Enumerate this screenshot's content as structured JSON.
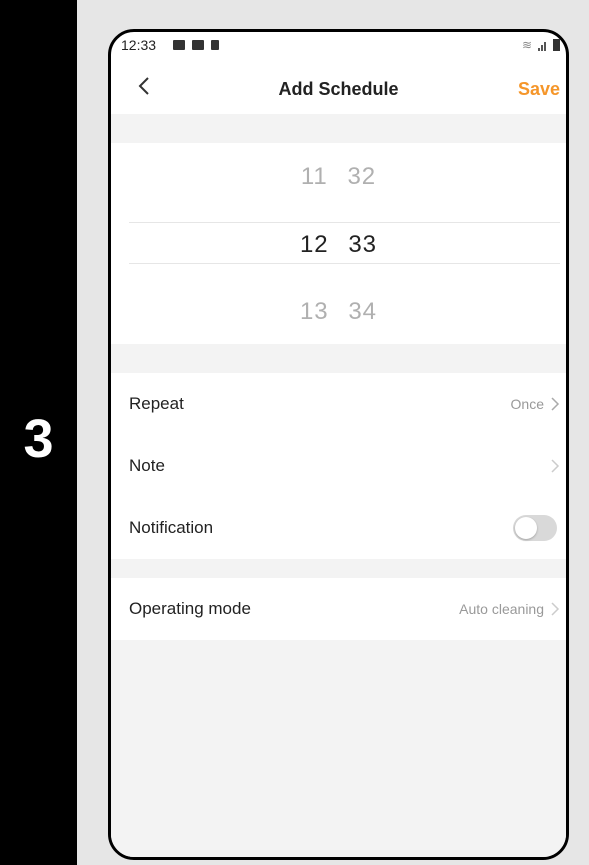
{
  "step": {
    "number": "3"
  },
  "status_bar": {
    "time": "12:33",
    "left_icons": [
      "image-icon",
      "app-icon",
      "sim-icon"
    ],
    "right_icons": [
      "wifi-icon",
      "signal-icon",
      "battery-icon"
    ]
  },
  "header": {
    "back_icon": "chevron-left-icon",
    "title": "Add Schedule",
    "save_label": "Save",
    "save_color": "#f5962a"
  },
  "time_picker": {
    "rows": [
      {
        "hour": "11",
        "minute": "32"
      },
      {
        "hour": "12",
        "minute": "33"
      },
      {
        "hour": "13",
        "minute": "34"
      }
    ],
    "selected_hour": "12",
    "selected_minute": "33"
  },
  "settings": [
    {
      "label": "Repeat",
      "value": "Once"
    },
    {
      "label": "Note",
      "value": ""
    },
    {
      "label": "Notification",
      "toggle_on": false
    }
  ],
  "mode": {
    "label": "Operating mode",
    "value": "Auto cleaning"
  }
}
